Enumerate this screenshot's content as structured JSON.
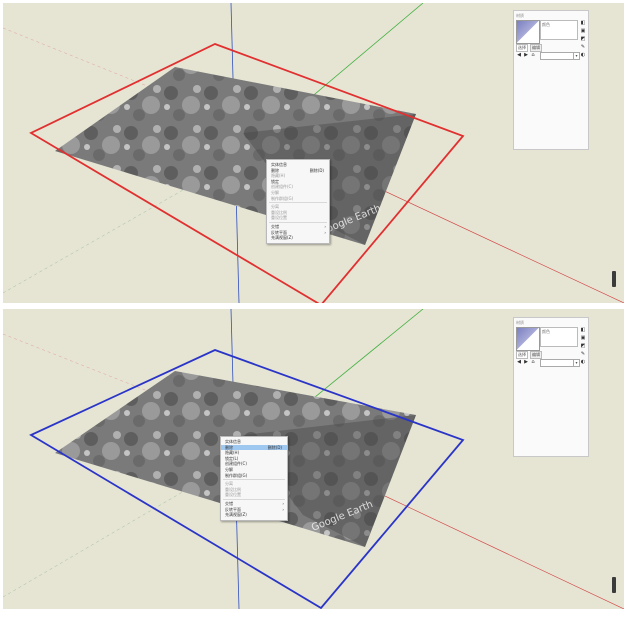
{
  "colors": {
    "viewport_bg": "#e6e4d3",
    "bbox_top": "#e03030",
    "bbox_bottom": "#2a35c8",
    "menu_highlight": "#9fc8f0",
    "axis_red": "#d04040",
    "axis_green": "#40b040",
    "axis_blue": "#3050c0"
  },
  "terrain_watermark": "Google Earth",
  "top_panel": {
    "context_menu": {
      "items": [
        {
          "label": "实体信息",
          "state": "normal"
        },
        {
          "label": "删除",
          "shortcut": "删除(D)",
          "state": "normal"
        },
        {
          "label": "隐藏(H)",
          "state": "dim"
        },
        {
          "label": "锁定",
          "state": "normal"
        },
        {
          "label": "创建组件(C)",
          "state": "dim"
        },
        {
          "label": "分解",
          "state": "dim"
        },
        {
          "label": "制作群组(G)",
          "state": "dim"
        },
        {
          "separator": true
        },
        {
          "label": "分离",
          "state": "dim"
        },
        {
          "label": "重设比例",
          "state": "dim"
        },
        {
          "label": "重设位置",
          "state": "dim"
        },
        {
          "separator": true
        },
        {
          "label": "交错",
          "state": "normal",
          "submenu": true
        },
        {
          "label": "反转平面",
          "state": "normal",
          "submenu": true
        },
        {
          "label": "充满视窗(Z)",
          "state": "normal"
        }
      ]
    },
    "tray": {
      "title": "材质",
      "material_name": "颜色",
      "tabs": [
        "选择",
        "编辑"
      ]
    }
  },
  "bottom_panel": {
    "context_menu": {
      "items": [
        {
          "label": "实体信息",
          "state": "normal"
        },
        {
          "label": "删除",
          "shortcut": "删除(D)",
          "state": "selected"
        },
        {
          "label": "隐藏(H)",
          "state": "normal"
        },
        {
          "label": "锁定(L)",
          "state": "normal"
        },
        {
          "label": "创建组件(C)",
          "state": "normal"
        },
        {
          "label": "分解",
          "state": "normal"
        },
        {
          "label": "制作群组(G)",
          "state": "normal"
        },
        {
          "separator": true
        },
        {
          "label": "分离",
          "state": "dim"
        },
        {
          "label": "重设比例",
          "state": "dim"
        },
        {
          "label": "重设位置",
          "state": "dim"
        },
        {
          "separator": true
        },
        {
          "label": "交错",
          "state": "normal",
          "submenu": true
        },
        {
          "label": "反转平面",
          "state": "normal",
          "submenu": true
        },
        {
          "label": "充满视窗(Z)",
          "state": "normal"
        }
      ]
    },
    "tray": {
      "title": "材质",
      "material_name": "颜色",
      "tabs": [
        "选择",
        "编辑"
      ]
    }
  }
}
